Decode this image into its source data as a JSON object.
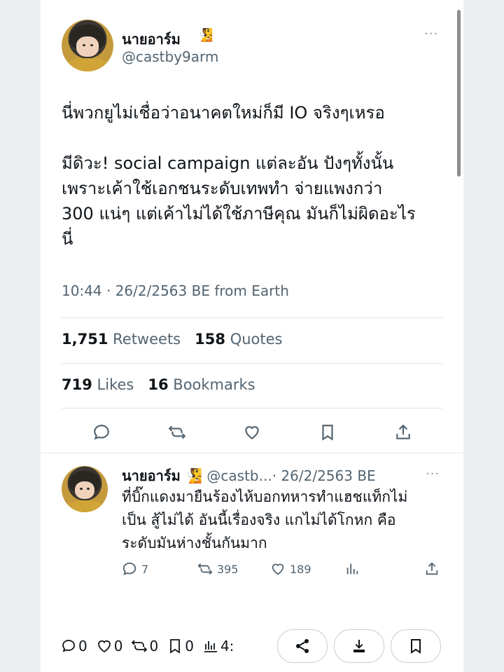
{
  "tweet": {
    "author_name": "นายอาร์ม",
    "author_emoji": "🧏",
    "handle": "@castby9arm",
    "more_label": "···",
    "text": "นี่พวกยูไม่เชื่อว่าอนาคตใหม่ก็มี IO จริงๆเหรอ\n\nมีดิวะ! social campaign แต่ละอัน ปังๆทั้งนั้น\nเพราะเค้าใช้เอกชนระดับเทพทำ จ่ายแพงกว่า\n300 แน่ๆ แต่เค้าไม่ได้ใช้ภาษีคุณ มันก็ไม่ผิดอะไร\nนี่",
    "timestamp": "10:44 · 26/2/2563 BE from Earth",
    "retweets_count": "1,751",
    "retweets_label": "Retweets",
    "quotes_count": "158",
    "quotes_label": "Quotes",
    "likes_count": "719",
    "likes_label": "Likes",
    "bookmarks_count": "16",
    "bookmarks_label": "Bookmarks"
  },
  "reply": {
    "author_name": "นายอาร์ม",
    "author_emoji": "🧏",
    "handle": "@castb...",
    "date": "· 26/2/2563 BE",
    "more_label": "···",
    "text": "ที่บิ๊กแดงมายืนร้องไห้บอกทหารทำแฮชแท็กไม่\nเป็น สู้ไม่ได้ อันนี้เรื่องจริง แกไม่ได้โกหก คือ\nระดับมันห่างชั้นกันมาก",
    "replies_count": "7",
    "retweets_count": "395",
    "likes_count": "189"
  },
  "bottom_bar": {
    "comments_count": "0",
    "likes_count": "0",
    "retweets_count": "0",
    "bookmarks_count": "0",
    "views_count": "4:"
  },
  "colors": {
    "text_primary": "#0f1419",
    "text_secondary": "#536471",
    "divider": "#e1e6ea",
    "background": "#eceef0",
    "card": "#ffffff"
  },
  "icons": [
    "reply-icon",
    "retweet-icon",
    "like-icon",
    "bookmark-icon",
    "share-icon",
    "views-icon",
    "download-icon",
    "more-icon"
  ]
}
